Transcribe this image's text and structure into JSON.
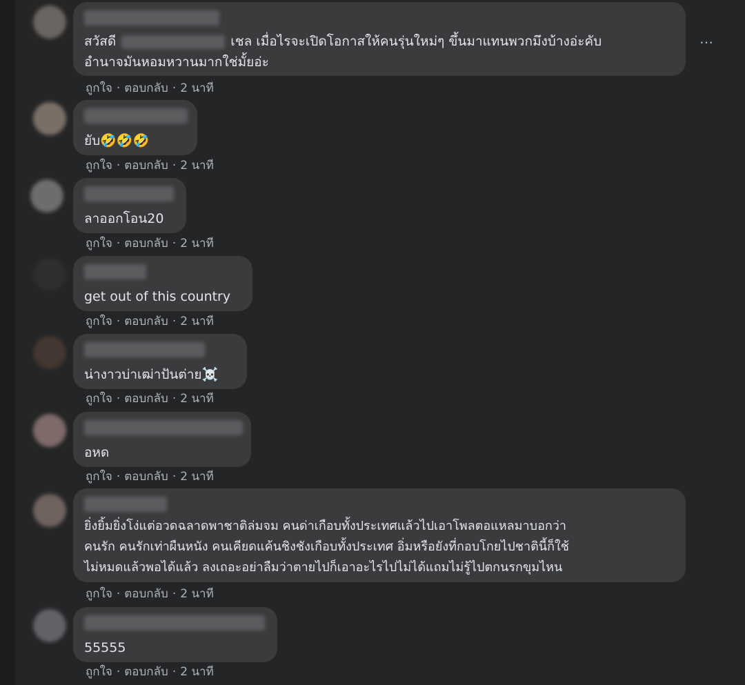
{
  "comments": [
    {
      "text_before": "สวัสดี",
      "text_after": "เชล เมื่อไรจะเปิดโอกาสให้คนรุ่นใหม่ๆ ขึ้นมาแทนพวกมึงบ้างอ่ะคับ",
      "text_line2": "อำนาจมันหอมหวานมากใช่มั้ยอ่ะ",
      "like": "ถูกใจ",
      "reply": "ตอบกลับ",
      "time": "2 นาที"
    },
    {
      "text": "ยับ🤣🤣🤣",
      "like": "ถูกใจ",
      "reply": "ตอบกลับ",
      "time": "2 นาที"
    },
    {
      "text": "ลาออกโอน20",
      "like": "ถูกใจ",
      "reply": "ตอบกลับ",
      "time": "2 นาที"
    },
    {
      "text": "get out of this country",
      "like": "ถูกใจ",
      "reply": "ตอบกลับ",
      "time": "2 นาที"
    },
    {
      "text": "น่างาวบ่าเฒ่าปันต่าย☠️",
      "like": "ถูกใจ",
      "reply": "ตอบกลับ",
      "time": "2 นาที"
    },
    {
      "text": "อหด",
      "like": "ถูกใจ",
      "reply": "ตอบกลับ",
      "time": "2 นาที"
    },
    {
      "text": "ยิ่งยิ้มยิ่งโง่แต่อวดฉลาดพาชาติล่มจม คนด่าเกือบทั้งประเทศแล้วไปเอาโพลตอแหลมาบอกว่า\nคนรัก คนรักเท่าผืนหนัง คนเคียดแค้นชิงชังเกือบทั้งประเทศ อิ่มหรือยังที่กอบโกยไปชาตินี้ก็ใช้\nไม่หมดแล้วพอได้แล้ว ลงเถอะอย่าลืมว่าตายไปก็เอาอะไรไปไม่ได้แถมไม่รู้ไปตกนรกขุมไหน",
      "like": "ถูกใจ",
      "reply": "ตอบกลับ",
      "time": "2 นาที"
    },
    {
      "text": "55555",
      "like": "ถูกใจ",
      "reply": "ตอบกลับ",
      "time": "2 นาที"
    }
  ],
  "more_icon": "…",
  "separator": "·"
}
